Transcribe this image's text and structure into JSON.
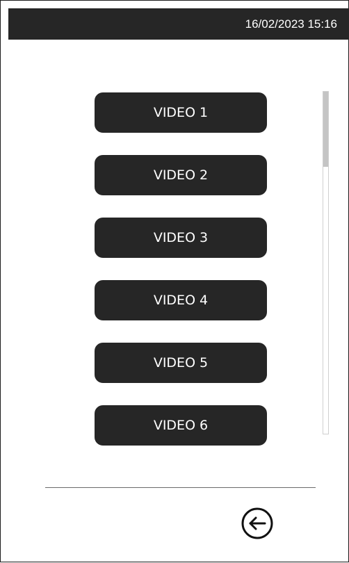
{
  "status_bar": {
    "datetime": "16/02/2023 15:16"
  },
  "video_list": {
    "items": [
      {
        "label": "VIDEO 1"
      },
      {
        "label": "VIDEO 2"
      },
      {
        "label": "VIDEO 3"
      },
      {
        "label": "VIDEO 4"
      },
      {
        "label": "VIDEO 5"
      },
      {
        "label": "VIDEO 6"
      }
    ]
  },
  "footer": {
    "back_icon": "arrow-left-circle-icon"
  },
  "colors": {
    "button_background": "#262626",
    "status_bar_background": "#262626",
    "scroll_thumb": "#c4c4c4"
  }
}
